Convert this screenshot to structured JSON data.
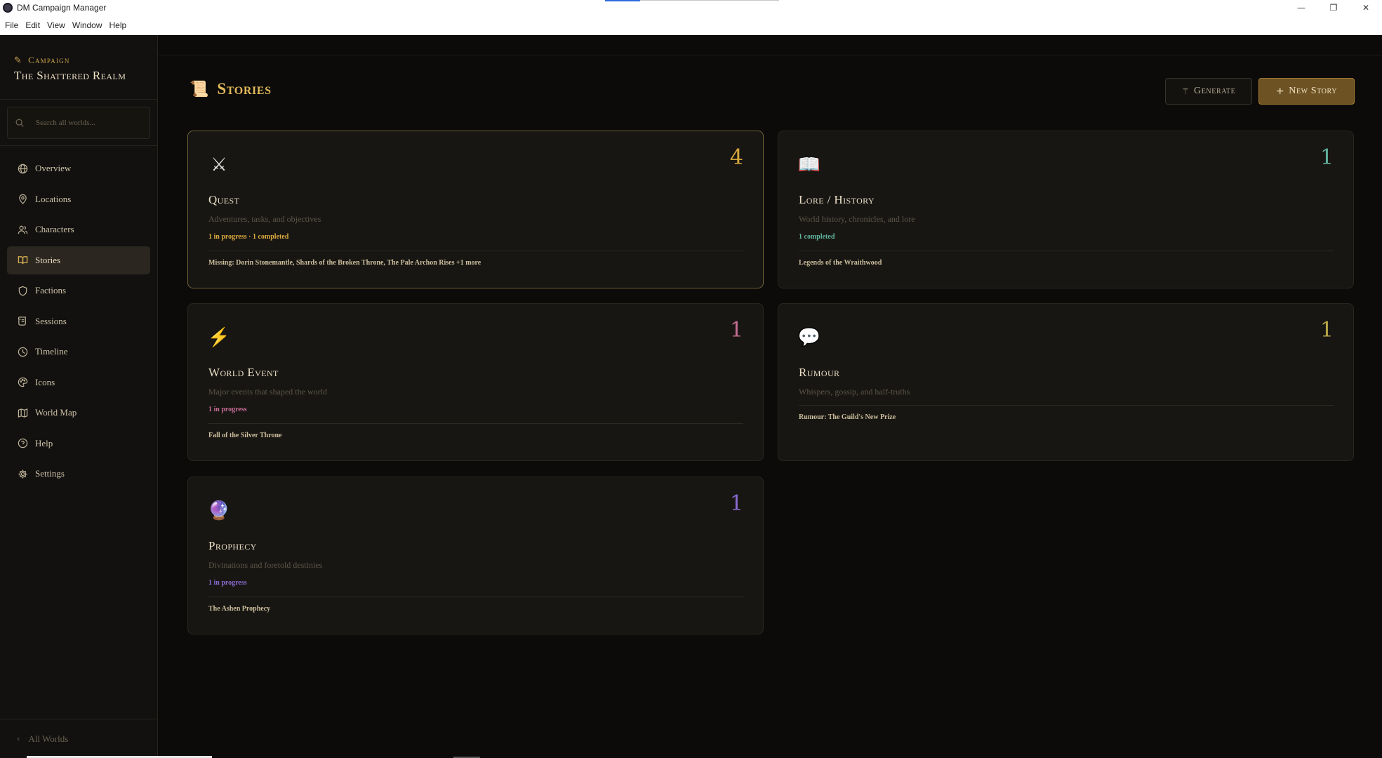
{
  "window": {
    "title": "DM Campaign Manager",
    "controls": {
      "minimize": "—",
      "restore": "❐",
      "close": "✕"
    }
  },
  "menu": [
    "File",
    "Edit",
    "View",
    "Window",
    "Help"
  ],
  "sidebar": {
    "campaign_label": "Campaign",
    "campaign_name": "The Shattered Realm",
    "search_placeholder": "Search all worlds...",
    "items": [
      {
        "label": "Overview",
        "icon": "globe-icon"
      },
      {
        "label": "Locations",
        "icon": "map-pin-icon"
      },
      {
        "label": "Characters",
        "icon": "users-icon"
      },
      {
        "label": "Stories",
        "icon": "book-open-icon",
        "active": true
      },
      {
        "label": "Factions",
        "icon": "shield-icon"
      },
      {
        "label": "Sessions",
        "icon": "scroll-icon"
      },
      {
        "label": "Timeline",
        "icon": "clock-icon"
      },
      {
        "label": "Icons",
        "icon": "palette-icon"
      },
      {
        "label": "World Map",
        "icon": "map-icon"
      },
      {
        "label": "Help",
        "icon": "help-circle-icon"
      },
      {
        "label": "Settings",
        "icon": "gear-icon"
      }
    ],
    "footer": "All Worlds"
  },
  "page": {
    "title": "Stories",
    "generate_label": "Generate",
    "new_story_label": "New Story"
  },
  "cards": [
    {
      "icon": "crossed-swords-icon",
      "glyph": "⚔",
      "count": "4",
      "count_color": "#d6a73d",
      "title": "Quest",
      "description": "Adventures, tasks, and objectives",
      "status": "1 in progress · 1 completed",
      "status_color": "#d9aa3e",
      "items": "Missing: Dorin Stonemantle, Shards of the Broken Throne, The Pale Archon Rises +1 more"
    },
    {
      "icon": "open-book-icon",
      "glyph": "📖",
      "count": "1",
      "count_color": "#5fb39b",
      "title": "Lore / History",
      "description": "World history, chronicles, and lore",
      "status": "1 completed",
      "status_color": "#5fb39b",
      "items": "Legends of the Wraithwood"
    },
    {
      "icon": "lightning-icon",
      "glyph": "⚡",
      "count": "1",
      "count_color": "#c46b93",
      "title": "World Event",
      "description": "Major events that shaped the world",
      "status": "1 in progress",
      "status_color": "#c46b93",
      "items": "Fall of the Silver Throne"
    },
    {
      "icon": "speech-bubble-icon",
      "glyph": "💬",
      "count": "1",
      "count_color": "#b8a648",
      "title": "Rumour",
      "description": "Whispers, gossip, and half-truths",
      "status": "",
      "status_color": "#b8a648",
      "items": "Rumour: The Guild's New Prize"
    },
    {
      "icon": "crystal-ball-icon",
      "glyph": "🔮",
      "count": "1",
      "count_color": "#8a6ad0",
      "title": "Prophecy",
      "description": "Divinations and foretold destinies",
      "status": "1 in progress",
      "status_color": "#8a6ad0",
      "items": "The Ashen Prophecy"
    }
  ]
}
